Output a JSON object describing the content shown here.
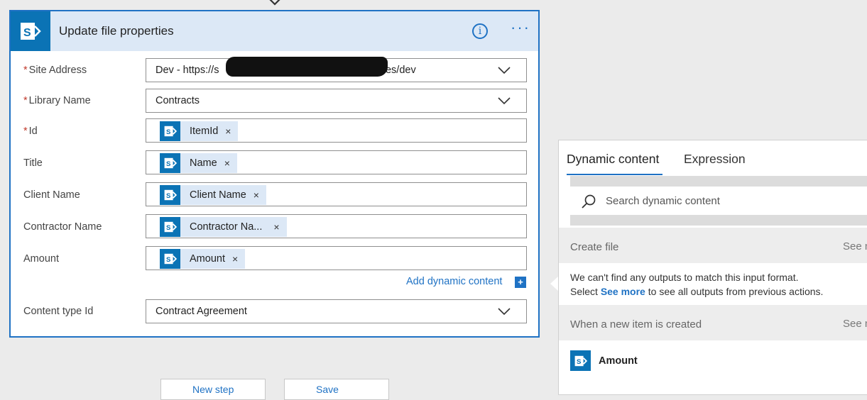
{
  "action": {
    "title": "Update file properties",
    "info_symbol": "i",
    "more_symbol": "···",
    "fields": [
      {
        "label": "Site Address",
        "required": true,
        "value_prefix": "Dev - https://s",
        "value_suffix": "/sites/dev",
        "kind": "dropdown"
      },
      {
        "label": "Library Name",
        "required": true,
        "value": "Contracts",
        "kind": "dropdown"
      },
      {
        "label": "Id",
        "required": true,
        "token": "ItemId",
        "kind": "token"
      },
      {
        "label": "Title",
        "required": false,
        "token": "Name",
        "kind": "token"
      },
      {
        "label": "Client Name",
        "required": false,
        "token": "Client Name",
        "kind": "token"
      },
      {
        "label": "Contractor Name",
        "required": false,
        "token": "Contractor Na...",
        "kind": "token"
      },
      {
        "label": "Amount",
        "required": false,
        "token": "Amount",
        "kind": "token"
      },
      {
        "label": "Content type Id",
        "required": false,
        "value": "Contract Agreement",
        "kind": "dropdown"
      }
    ],
    "required_marker": "*",
    "token_remove": "×",
    "add_dynamic_label": "Add dynamic content",
    "add_dynamic_symbol": "+"
  },
  "bottom_buttons": [
    {
      "label": "New step"
    },
    {
      "label": "Save"
    }
  ],
  "dynamic_panel": {
    "tabs": [
      {
        "label": "Dynamic content",
        "active": true
      },
      {
        "label": "Expression",
        "active": false
      }
    ],
    "search_placeholder": "Search dynamic content",
    "sections": [
      {
        "title": "Create file",
        "see_more": "See more"
      },
      {
        "title": "When a new item is created",
        "see_more": "See more"
      }
    ],
    "message_line1": "We can't find any outputs to match this input format.",
    "message_line2_pre": "Select ",
    "message_link": "See more",
    "message_line2_post": " to see all outputs from previous actions.",
    "items": [
      {
        "label": "Amount"
      }
    ]
  },
  "colors": {
    "accent": "#1f72c4",
    "sharepoint_blue": "#0b73b5",
    "header_bg": "#dce8f6",
    "required_red": "#c0392b",
    "canvas_bg": "#ebebeb"
  }
}
